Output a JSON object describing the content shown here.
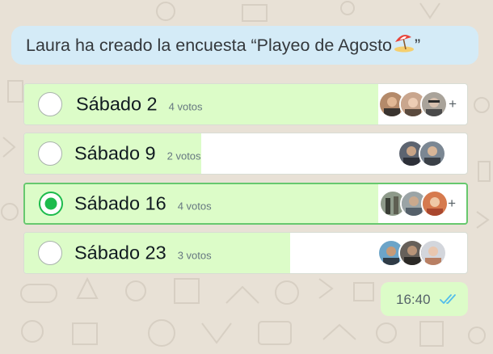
{
  "chat": {
    "system_message": "Laura ha creado la encuesta “Playeo de Agosto",
    "system_message_emoji": "beach-umbrella-emoji",
    "system_message_end": " ”"
  },
  "poll": {
    "options": [
      {
        "label": "Sábado 2",
        "votes_text": "4 votos",
        "votes": 4,
        "selected": false,
        "fill_fraction": 0.8,
        "avatars": 3,
        "more": "+"
      },
      {
        "label": "Sábado 9",
        "votes_text": "2 votos",
        "votes": 2,
        "selected": false,
        "fill_fraction": 0.4,
        "avatars": 2,
        "more": ""
      },
      {
        "label": "Sábado 16",
        "votes_text": "4 votos",
        "votes": 4,
        "selected": true,
        "fill_fraction": 0.8,
        "avatars": 3,
        "more": "+"
      },
      {
        "label": "Sábado 23",
        "votes_text": "3 votos",
        "votes": 3,
        "selected": false,
        "fill_fraction": 0.6,
        "avatars": 3,
        "more": ""
      }
    ]
  },
  "message": {
    "time": "16:40",
    "status_icon": "double-check-read-icon",
    "status_color": "#53bdeb"
  },
  "colors": {
    "bar_fill": "#dcfcc8",
    "radio_selected": "#1dbb4d",
    "banner": "#d4ebf7"
  }
}
